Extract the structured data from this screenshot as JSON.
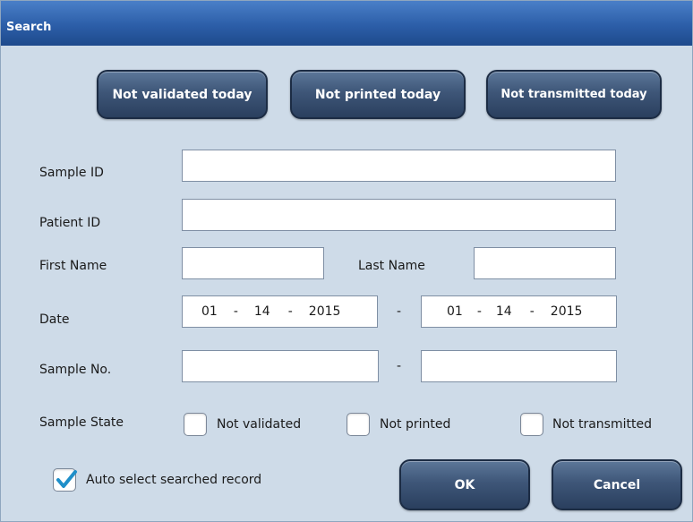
{
  "window": {
    "title": "Search"
  },
  "quick_filters": {
    "not_validated_today": "Not validated today",
    "not_printed_today": "Not printed today",
    "not_transmitted_today": "Not transmitted today"
  },
  "fields": {
    "sample_id": {
      "label": "Sample ID",
      "value": ""
    },
    "patient_id": {
      "label": "Patient ID",
      "value": ""
    },
    "first_name": {
      "label": "First Name",
      "value": ""
    },
    "last_name": {
      "label": "Last Name",
      "value": ""
    },
    "date": {
      "label": "Date",
      "from": {
        "month": "01",
        "day": "14",
        "year": "2015"
      },
      "to": {
        "month": "01",
        "day": "14",
        "year": "2015"
      },
      "dash": "-",
      "range_sep": "-"
    },
    "sample_no": {
      "label": "Sample No.",
      "from": "",
      "to": "",
      "range_sep": "-"
    }
  },
  "sample_state": {
    "label": "Sample State",
    "options": [
      {
        "label": "Not validated",
        "checked": false
      },
      {
        "label": "Not printed",
        "checked": false
      },
      {
        "label": "Not transmitted",
        "checked": false
      }
    ]
  },
  "auto_select": {
    "label": "Auto select searched record",
    "checked": true,
    "check_color": "#1f8fc9"
  },
  "footer": {
    "ok_label": "OK",
    "cancel_label": "Cancel"
  },
  "colors": {
    "titlebar": "#2c5ea8",
    "background": "#cedbe8",
    "button": "#3e5678"
  }
}
